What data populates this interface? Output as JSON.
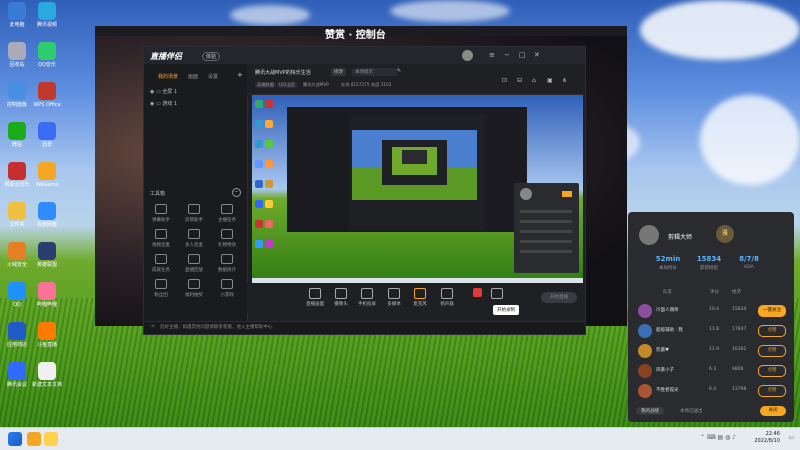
{
  "desktop": {
    "icons": [
      {
        "label": "此电脑"
      },
      {
        "label": "腾讯视频"
      },
      {
        "label": "回收站"
      },
      {
        "label": "QQ音乐"
      },
      {
        "label": "控制面板"
      },
      {
        "label": "WPS Office"
      },
      {
        "label": "微信"
      },
      {
        "label": "迅雷"
      },
      {
        "label": "网易云音乐"
      },
      {
        "label": "WeGame"
      },
      {
        "label": "文件夹"
      },
      {
        "label": "百度网盘"
      },
      {
        "label": "火绒安全"
      },
      {
        "label": "英雄联盟"
      },
      {
        "label": "QQ"
      },
      {
        "label": "哔哩哔哩"
      },
      {
        "label": "应用商店"
      },
      {
        "label": "斗鱼直播"
      },
      {
        "label": "腾讯会议"
      },
      {
        "label": "新建文本文档"
      }
    ]
  },
  "app": {
    "brand": "直播伴侣",
    "badge": "体验",
    "title_behind": "赞赏 · 控制台",
    "left_tabs": [
      "我的场景",
      "画面",
      "设置"
    ],
    "scenes": [
      "全屏 1",
      "游戏 1"
    ],
    "tools_heading": "工具箱",
    "tools": [
      "弹幕助手",
      "房管助手",
      "主播任务",
      "视频连麦",
      "多人连麦",
      "礼物特效",
      "成就任务",
      "直播回放",
      "数据统计",
      "粉丝团",
      "福利抽奖",
      "小游戏"
    ],
    "info": {
      "room_title": "腾讯大战MVP的快乐生活",
      "edit_label": "修改",
      "notice": "本场提示",
      "tags": [
        "英雄联盟",
        "LOL全区",
        "腾讯大战MVP",
        "在线 8157275",
        "热度 3102"
      ]
    },
    "controls": [
      "直播画面",
      "摄像头",
      "手机投屏",
      "多媒体",
      "麦克风",
      "扬声器",
      "录制",
      "设置"
    ],
    "start_button": "开始直播",
    "tooltip": "开始录制",
    "status": "您好主播，如遇其他问题请联系客服，进入主播帮助中心"
  },
  "panel": {
    "name": "剪辑大师",
    "stats": [
      {
        "value": "52min",
        "label": "本局时长"
      },
      {
        "value": "15834",
        "label": "获得经验"
      },
      {
        "value": "8/7/8",
        "label": "KDA"
      }
    ],
    "headers": [
      "队友",
      "评分",
      "经济"
    ],
    "players": [
      {
        "name": "冷面人偶师",
        "score": "10.4",
        "gold": "15834",
        "action": "一键关注"
      },
      {
        "name": "超级辅助 · 我",
        "score": "11.8",
        "gold": "17847",
        "action": "点赞"
      },
      {
        "name": "凯酱♥",
        "score": "11.9",
        "gold": "16302",
        "action": "点赞"
      },
      {
        "name": "风暴小子",
        "score": "6.3",
        "gold": "9806",
        "action": "点赞"
      },
      {
        "name": "不胜者孤光",
        "score": "6.4",
        "gold": "13798",
        "action": "点赞"
      }
    ],
    "footer_left": "我的战绩",
    "footer_mid": "本场已送出",
    "footer_btn": "关闭"
  },
  "clock": {
    "time": "22:46",
    "date": "2022/8/10"
  },
  "colors": {
    "accent": "#f5a623",
    "blue": "#5cb3ff"
  }
}
